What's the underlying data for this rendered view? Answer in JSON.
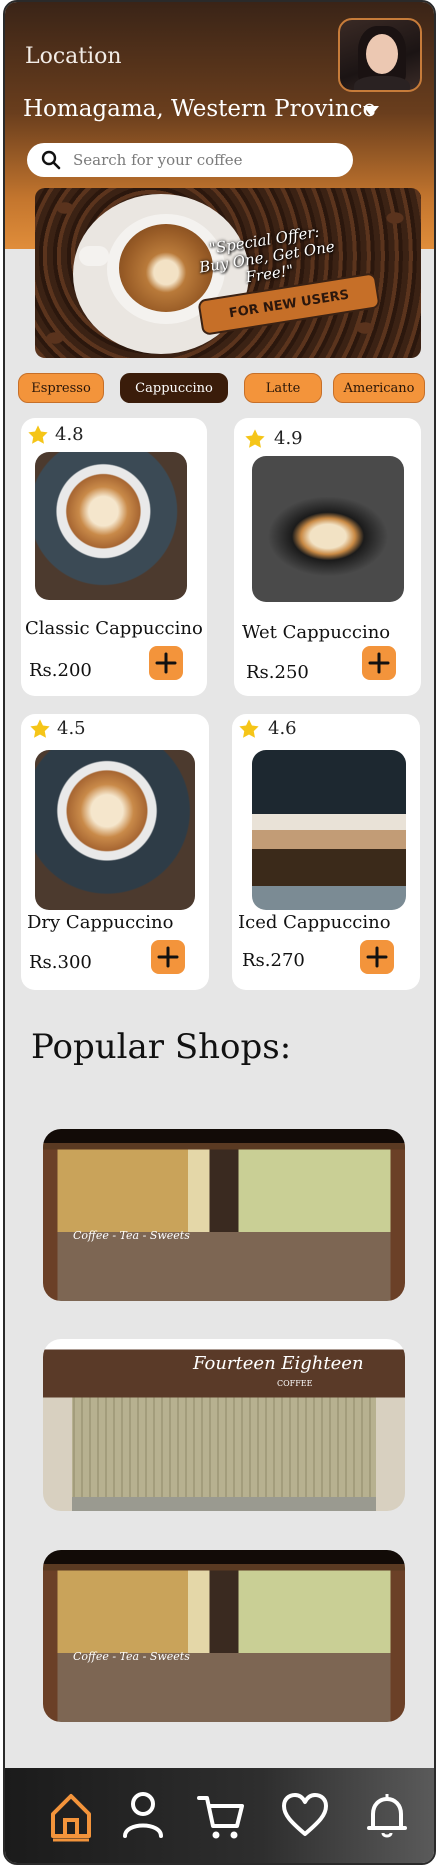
{
  "header": {
    "location_label": "Location",
    "location_value": "Homagama, Western Province",
    "search_placeholder": "Search for your coffee"
  },
  "icons": [
    "search-icon",
    "chevron-down-icon",
    "star-icon",
    "plus-icon",
    "home-icon",
    "profile-icon",
    "cart-icon",
    "heart-icon",
    "bell-icon"
  ],
  "banner": {
    "offer_line1": "\"Special Offer:",
    "offer_line2": "Buy One, Get One Free!\"",
    "tag": "FOR NEW USERS"
  },
  "categories": [
    {
      "label": "Espresso",
      "active": false
    },
    {
      "label": "Cappuccino",
      "active": true
    },
    {
      "label": "Latte",
      "active": false
    },
    {
      "label": "Americano",
      "active": false
    }
  ],
  "products": [
    {
      "name": "Classic Cappuccino",
      "price": "Rs.200",
      "rating": "4.8"
    },
    {
      "name": "Wet Cappuccino",
      "price": "Rs.250",
      "rating": "4.9"
    },
    {
      "name": "Dry Cappuccino",
      "price": "Rs.300",
      "rating": "4.5"
    },
    {
      "name": "Iced Cappuccino",
      "price": "Rs.270",
      "rating": "4.6"
    }
  ],
  "popular": {
    "title": "Popular Shops:",
    "shops": [
      {
        "sign": "Coffee - Tea - Sweets"
      },
      {
        "sign": "Fourteen Eighteen",
        "sub": "COFFEE"
      },
      {
        "sign": "Coffee - Tea - Sweets"
      }
    ]
  },
  "colors": {
    "accent": "#f3943b",
    "dark_brown": "#3a1c0a",
    "header_top": "#3a2417",
    "header_bottom": "#e08d3a",
    "nav_active": "#f3943b",
    "background": "#e6e6e6"
  }
}
